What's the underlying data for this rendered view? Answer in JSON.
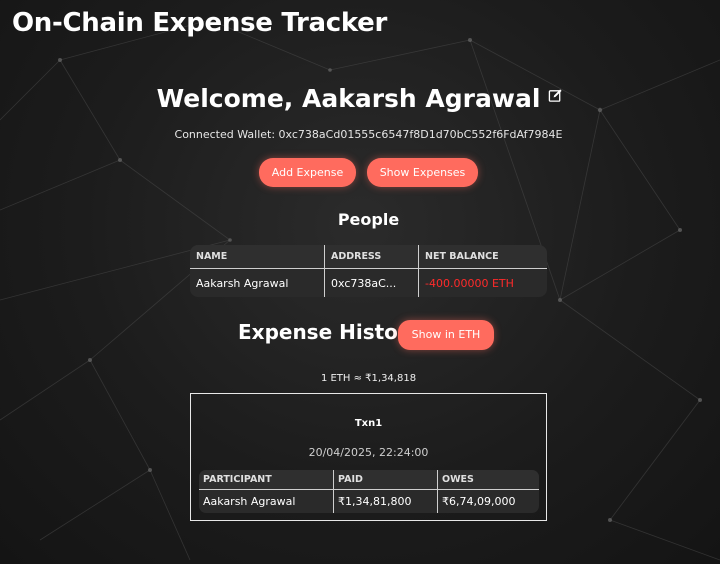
{
  "app": {
    "title": "On-Chain Expense Tracker"
  },
  "welcome": {
    "text": "Welcome, Aakarsh Agrawal",
    "edit_icon": "edit-icon"
  },
  "wallet": {
    "text": "Connected Wallet: 0xc738aCd01555c6547f8D1d70bC552f6FdAf7984E"
  },
  "actions": {
    "add_label": "Add Expense",
    "show_label": "Show Expenses"
  },
  "people": {
    "heading": "People",
    "columns": [
      "NAME",
      "ADDRESS",
      "NET BALANCE"
    ],
    "rows": [
      {
        "name": "Aakarsh Agrawal",
        "address": "0xc738aC...",
        "balance": "-400.00000 ETH"
      }
    ]
  },
  "history": {
    "heading": "Expense History",
    "toggle_label": "Show in ETH",
    "rate": "1 ETH ≈ ₹1,34,818",
    "transactions": [
      {
        "name": "Txn1",
        "date": "20/04/2025, 22:24:00",
        "columns": [
          "PARTICIPANT",
          "PAID",
          "OWES"
        ],
        "rows": [
          {
            "participant": "Aakarsh Agrawal",
            "paid": "₹1,34,81,800",
            "owes": "₹6,74,09,000"
          }
        ]
      }
    ]
  },
  "colors": {
    "accent": "#ff6b5e",
    "negative": "#ff2a2a",
    "background": "#1c1c1c"
  }
}
